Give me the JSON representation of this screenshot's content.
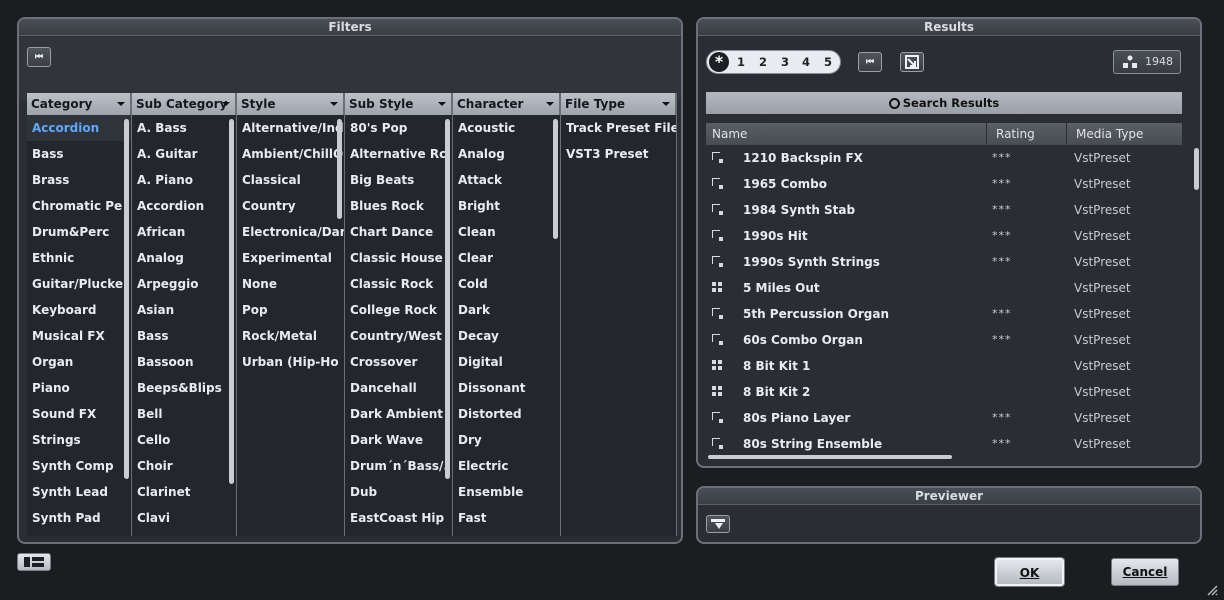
{
  "filters": {
    "title": "Filters",
    "columns": [
      {
        "header": "Category",
        "items": [
          "Accordion",
          "Bass",
          "Brass",
          "Chromatic Pe",
          "Drum&Perc",
          "Ethnic",
          "Guitar/Plucke",
          "Keyboard",
          "Musical FX",
          "Organ",
          "Piano",
          "Sound FX",
          "Strings",
          "Synth Comp",
          "Synth Lead",
          "Synth Pad"
        ],
        "selected": 0
      },
      {
        "header": "Sub Category",
        "items": [
          "A. Bass",
          "A. Guitar",
          "A. Piano",
          "Accordion",
          "African",
          "Analog",
          "Arpeggio",
          "Asian",
          "Bass",
          "Bassoon",
          "Beeps&Blips",
          "Bell",
          "Cello",
          "Choir",
          "Clarinet",
          "Clavi"
        ]
      },
      {
        "header": "Style",
        "items": [
          "Alternative/Ind",
          "Ambient/ChillO",
          "Classical",
          "Country",
          "Electronica/Dar",
          "Experimental",
          "None",
          "Pop",
          "Rock/Metal",
          "Urban (Hip-Ho"
        ]
      },
      {
        "header": "Sub Style",
        "items": [
          "80's Pop",
          "Alternative Rc",
          "Big Beats",
          "Blues Rock",
          "Chart Dance",
          "Classic House",
          "Classic Rock",
          "College Rock",
          "Country/West",
          "Crossover",
          "Dancehall",
          "Dark Ambient",
          "Dark Wave",
          "Drum´n´Bass/.",
          "Dub",
          "EastCoast Hip"
        ]
      },
      {
        "header": "Character",
        "items": [
          "Acoustic",
          "Analog",
          "Attack",
          "Bright",
          "Clean",
          "Clear",
          "Cold",
          "Dark",
          "Decay",
          "Digital",
          "Dissonant",
          "Distorted",
          "Dry",
          "Electric",
          "Ensemble",
          "Fast"
        ]
      },
      {
        "header": "File Type",
        "items": [
          "Track Preset File",
          "VST3 Preset"
        ]
      }
    ]
  },
  "results": {
    "title": "Results",
    "pages": [
      "1",
      "2",
      "3",
      "4",
      "5"
    ],
    "count": "1948",
    "search_label": "Search Results",
    "headers": {
      "name": "Name",
      "rating": "Rating",
      "media": "Media Type"
    },
    "rows": [
      {
        "icon": "preset",
        "name": "1210 Backspin FX",
        "rating": "***",
        "media": "VstPreset"
      },
      {
        "icon": "preset",
        "name": "1965 Combo",
        "rating": "***",
        "media": "VstPreset"
      },
      {
        "icon": "preset",
        "name": "1984 Synth Stab",
        "rating": "***",
        "media": "VstPreset"
      },
      {
        "icon": "preset",
        "name": "1990s Hit",
        "rating": "***",
        "media": "VstPreset"
      },
      {
        "icon": "preset",
        "name": "1990s Synth Strings",
        "rating": "***",
        "media": "VstPreset"
      },
      {
        "icon": "kit",
        "name": "5 Miles Out",
        "rating": "",
        "media": "VstPreset"
      },
      {
        "icon": "preset",
        "name": "5th Percussion Organ",
        "rating": "***",
        "media": "VstPreset"
      },
      {
        "icon": "preset",
        "name": "60s Combo Organ",
        "rating": "***",
        "media": "VstPreset"
      },
      {
        "icon": "kit",
        "name": "8 Bit Kit 1",
        "rating": "",
        "media": "VstPreset"
      },
      {
        "icon": "kit",
        "name": "8 Bit Kit 2",
        "rating": "",
        "media": "VstPreset"
      },
      {
        "icon": "preset",
        "name": "80s Piano Layer",
        "rating": "***",
        "media": "VstPreset"
      },
      {
        "icon": "preset",
        "name": "80s String Ensemble",
        "rating": "***",
        "media": "VstPreset"
      }
    ]
  },
  "previewer": {
    "title": "Previewer"
  },
  "buttons": {
    "ok": "OK",
    "cancel": "Cancel"
  }
}
